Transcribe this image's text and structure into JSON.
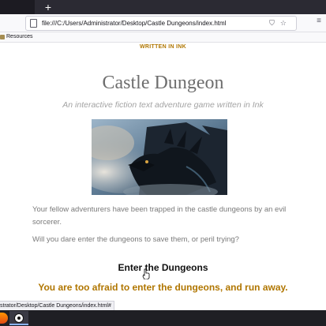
{
  "browser": {
    "url": "file:///C:/Users/Administrator/Desktop/Castle Dungeons/index.html",
    "newtab_label": "+",
    "bookmark_label": "Resources",
    "url_actions": "☆ ⛉ ☆",
    "menu_icon": "≡"
  },
  "page": {
    "byline": "WRITTEN IN INK",
    "title": "Castle Dungeon",
    "subtitle": "An interactive fiction text adventure game written in Ink",
    "paragraph1": "Your fellow adventurers have been trapped in the castle dungeons by an evil sorcerer.",
    "paragraph2": "Will you dare enter the dungeons to save them, or peril trying?",
    "choice_enter": "Enter the Dungeons",
    "choice_flee": "You are too afraid to enter the dungeons, and run away."
  },
  "status": {
    "link_preview": "strator/Desktop/Castle Dungeons/index.html#"
  },
  "colors": {
    "accent": "#b07600",
    "title": "#6e6e6e",
    "subtitle": "#a3a3a3",
    "body_text": "#7a7a7a"
  }
}
